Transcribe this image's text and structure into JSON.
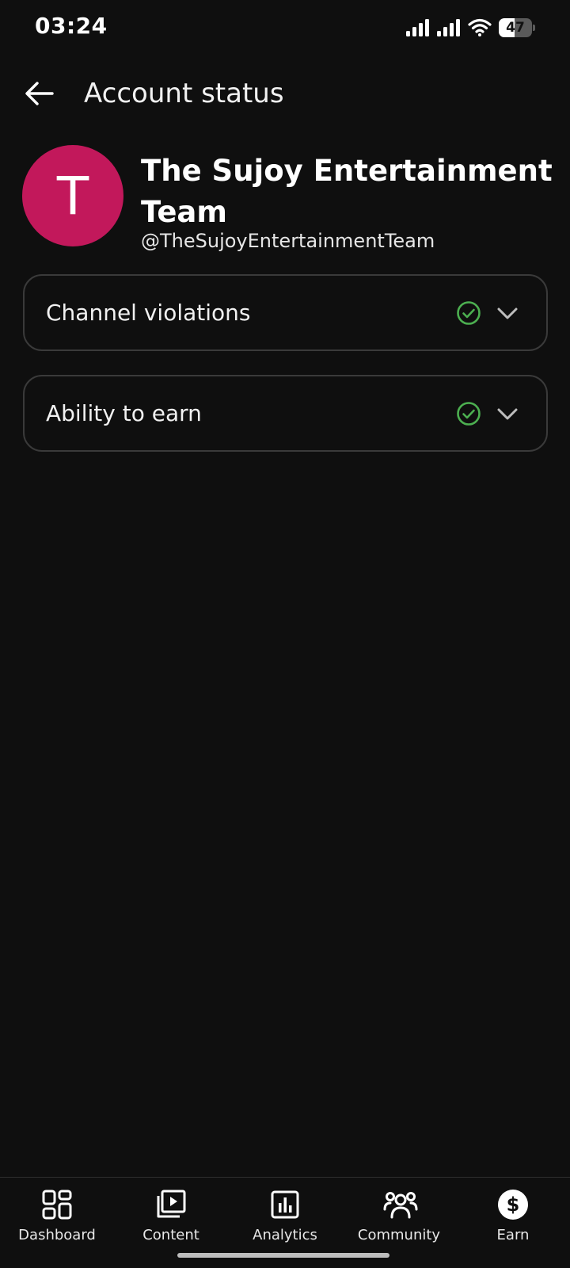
{
  "status_bar": {
    "time": "03:24",
    "battery_level": "47",
    "battery_fraction": 0.47,
    "icons": [
      "signal-icon",
      "signal-icon",
      "wifi-icon",
      "battery-icon"
    ]
  },
  "header": {
    "title": "Account status",
    "back_icon": "arrow-left-icon"
  },
  "channel": {
    "avatar_letter": "T",
    "avatar_color": "#c2185b",
    "name": "The Sujoy Entertainment Team",
    "handle": "@TheSujoyEntertainmentTeam"
  },
  "cards": [
    {
      "label": "Channel violations",
      "status": "ok",
      "status_icon": "check-circle-icon",
      "expand_icon": "chevron-down-icon"
    },
    {
      "label": "Ability to earn",
      "status": "ok",
      "status_icon": "check-circle-icon",
      "expand_icon": "chevron-down-icon"
    }
  ],
  "colors": {
    "background": "#0f0f0f",
    "check_green": "#4caf50",
    "card_border": "#3a3a3a"
  },
  "bottom_nav": {
    "items": [
      {
        "label": "Dashboard",
        "icon": "dashboard-icon"
      },
      {
        "label": "Content",
        "icon": "content-icon"
      },
      {
        "label": "Analytics",
        "icon": "analytics-icon"
      },
      {
        "label": "Community",
        "icon": "community-icon"
      },
      {
        "label": "Earn",
        "icon": "earn-icon",
        "active": true
      }
    ]
  }
}
